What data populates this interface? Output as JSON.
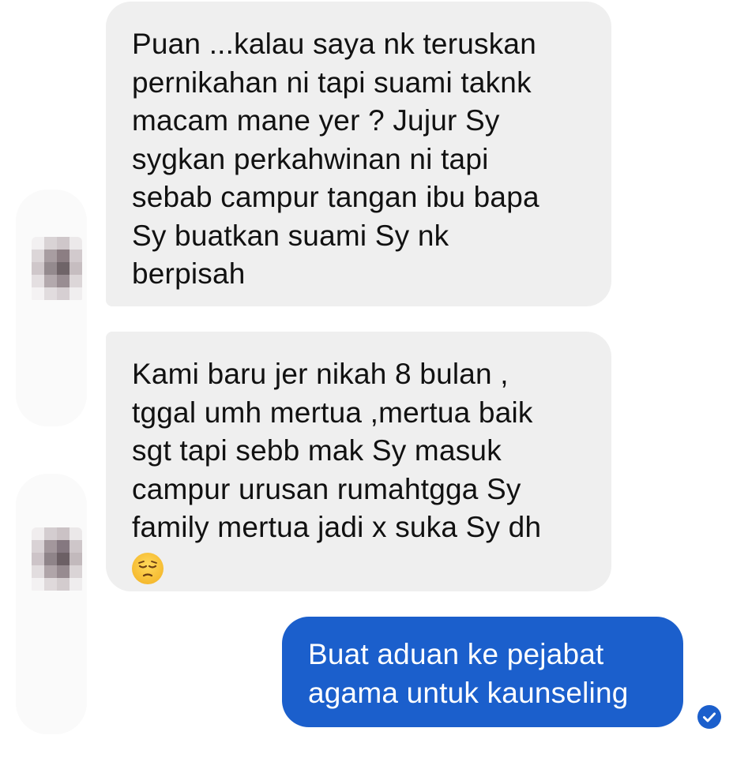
{
  "conversation": {
    "incoming_messages": [
      {
        "lines": [
          "Puan ...kalau saya nk teruskan",
          "pernikahan ni tapi suami taknk",
          "macam mane yer ? Jujur Sy",
          "sygkan perkahwinan ni tapi",
          "sebab campur tangan ibu bapa",
          "Sy buatkan suami Sy nk",
          "berpisah"
        ]
      },
      {
        "lines": [
          "Kami baru jer nikah 8 bulan ,",
          "tggal umh mertua ,mertua baik",
          "sgt tapi sebb mak Sy masuk",
          "campur urusan rumahtgga Sy",
          "family mertua jadi x suka Sy dh"
        ],
        "emoji": "pensive-face-emoji"
      }
    ],
    "outgoing_messages": [
      {
        "lines": [
          "Buat aduan ke pejabat",
          "agama untuk kaunseling"
        ],
        "status_icon": "read-receipt-check-icon"
      }
    ]
  },
  "colors": {
    "incoming_bubble": "#efefef",
    "incoming_text": "#111111",
    "outgoing_bubble": "#1b5fcc",
    "outgoing_text": "#ffffff",
    "background": "#ffffff"
  }
}
